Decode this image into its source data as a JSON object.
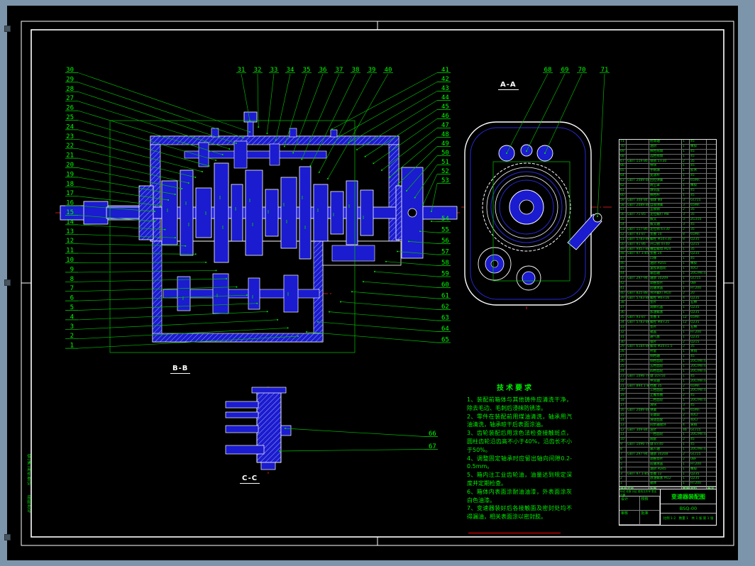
{
  "colors": {
    "desktop": "#7d95aa",
    "sheet": "#000000",
    "frame_white": "#ffffff",
    "part_blue": "#1b1bcf",
    "leader_green": "#00e000",
    "centerline_red": "#ff0000"
  },
  "drawing": {
    "view_labels": {
      "aa": "A-A",
      "bb": "B-B",
      "cc": "C-C"
    },
    "margin_labels": [
      "借(通)用件登记",
      "底图总号"
    ],
    "callouts": {
      "left": [
        "30",
        "29",
        "28",
        "27",
        "26",
        "25",
        "24",
        "23",
        "22",
        "21",
        "20",
        "19",
        "18",
        "17",
        "16",
        "15",
        "14",
        "13",
        "12",
        "11",
        "10",
        "9",
        "8",
        "7",
        "6",
        "5",
        "4",
        "3",
        "2",
        "1"
      ],
      "top": [
        "31",
        "32",
        "33",
        "34",
        "35",
        "36",
        "37",
        "38",
        "39",
        "40"
      ],
      "right_upper": [
        "41",
        "42",
        "43",
        "44",
        "45",
        "46",
        "47",
        "48",
        "49",
        "50",
        "51",
        "52",
        "53"
      ],
      "right_lower": [
        "54",
        "55",
        "56",
        "57",
        "58",
        "59",
        "60",
        "61",
        "62",
        "63",
        "64",
        "65"
      ],
      "cc_view": [
        "66",
        "67"
      ],
      "aa_top": [
        "68",
        "69",
        "70",
        "71"
      ]
    },
    "tech": {
      "title": "技术要求",
      "lines": [
        "1、装配前箱体与其他铸件应清洗干净，除去毛边、毛刺后浸抹防锈漆。",
        "2、零件在装配前用煤油清洗，轴承用汽油清洗，轴承晾干后表面涂油。",
        "3、齿轮装配后用涂色法检查接触斑点，圆柱齿轮沿齿高不小于40%，沿齿长不小于50%。",
        "4、调整固定轴承时应留出轴向间隙0.2-0.5mm。",
        "5、箱内注工业齿轮油，油量达到规定深度并定期检查。",
        "6、箱体内表面涂耐油油漆，外表面涂灰白色油漆。",
        "7、变速器装好后各接触面及密封处均不得漏油，相关表面涂以密封胶。"
      ]
    },
    "bom": {
      "headers": [
        "序号",
        "代号",
        "名称",
        "数量",
        "材料",
        "备注"
      ],
      "rows": [
        [
          "71",
          "",
          "摇臂轴",
          "1",
          "45",
          ""
        ],
        [
          "70",
          "",
          "油封",
          "1",
          "橡胶",
          ""
        ],
        [
          "69",
          "",
          "换档摇臂",
          "1",
          "45",
          ""
        ],
        [
          "68",
          "",
          "选档摇臂",
          "1",
          "45",
          ""
        ],
        [
          "67",
          "GB/T 119-86",
          "锁销 5×30",
          "2",
          "35",
          ""
        ],
        [
          "66",
          "",
          "导块",
          "1",
          "45",
          ""
        ],
        [
          "65",
          "",
          "手柄球",
          "1",
          "胶木",
          ""
        ],
        [
          "64",
          "",
          "变速杆",
          "1",
          "45",
          ""
        ],
        [
          "63",
          "GB/T 2089-80",
          "回位弹簧",
          "2",
          "65Mn",
          ""
        ],
        [
          "62",
          "",
          "防尘罩",
          "1",
          "橡胶",
          ""
        ],
        [
          "61",
          "",
          "球头座",
          "1",
          "45",
          ""
        ],
        [
          "60",
          "",
          "换档杆",
          "1",
          "45",
          ""
        ],
        [
          "59",
          "GB/T 308-84",
          "钢球 Φ8",
          "3",
          "GCr15",
          ""
        ],
        [
          "58",
          "GB/T 2089-80",
          "自锁弹簧",
          "3",
          "65Mn",
          ""
        ],
        [
          "57",
          "",
          "互锁销",
          "2",
          "35",
          ""
        ],
        [
          "56",
          "GB/T 71-85",
          "定位螺钉 M8",
          "3",
          "35",
          ""
        ],
        [
          "55",
          "",
          "拨叉",
          "3",
          "ZG310",
          ""
        ],
        [
          "54",
          "",
          "拨叉轴",
          "3",
          "45",
          ""
        ],
        [
          "53",
          "GB/T 117-86",
          "定位销 6×30",
          "2",
          "35",
          ""
        ],
        [
          "52",
          "GB/T 93-87",
          "垫圈 10",
          "8",
          "65Mn",
          ""
        ],
        [
          "51",
          "GB/T 5783-86",
          "螺栓 M10×30",
          "8",
          "Q235",
          ""
        ],
        [
          "50",
          "GB/T 91-86",
          "开口销 4×40",
          "1",
          "Q215",
          ""
        ],
        [
          "49",
          "GB/T 9457-88",
          "槽型螺母 M24",
          "1",
          "35",
          ""
        ],
        [
          "48",
          "GB/T 97.1-85",
          "垫圈 24",
          "1",
          "Q235",
          ""
        ],
        [
          "47",
          "",
          "凸缘",
          "1",
          "45",
          ""
        ],
        [
          "46",
          "",
          "油封 PD55",
          "1",
          "橡胶",
          ""
        ],
        [
          "45",
          "",
          "里程表齿轮",
          "1",
          "40Cr",
          ""
        ],
        [
          "44",
          "",
          "输出轴",
          "1",
          "20CrMnTi",
          ""
        ],
        [
          "43",
          "GB/T 297-94",
          "轴承 30209",
          "1",
          "GCr15",
          ""
        ],
        [
          "42",
          "",
          "调整垫片",
          "1",
          "08F",
          ""
        ],
        [
          "41",
          "",
          "后轴承盖",
          "1",
          "HT200",
          ""
        ],
        [
          "40",
          "GB/T 825-88",
          "吊环螺钉 M10",
          "2",
          "20",
          ""
        ],
        [
          "39",
          "GB/T 5783-86",
          "螺栓 M6×16",
          "4",
          "Q235",
          ""
        ],
        [
          "38",
          "",
          "垫片",
          "1",
          "石棉",
          ""
        ],
        [
          "37",
          "",
          "观察孔盖",
          "1",
          "Q235",
          ""
        ],
        [
          "36",
          "",
          "加油螺塞",
          "1",
          "Q235",
          ""
        ],
        [
          "35",
          "GB/T 93-87",
          "垫圈 8",
          "12",
          "65Mn",
          ""
        ],
        [
          "34",
          "GB/T 5783-86",
          "螺栓 M8×25",
          "12",
          "Q235",
          ""
        ],
        [
          "33",
          "",
          "垫片",
          "1",
          "石棉",
          ""
        ],
        [
          "32",
          "",
          "箱盖",
          "1",
          "HT200",
          ""
        ],
        [
          "31",
          "",
          "通气塞",
          "1",
          "Q235",
          ""
        ],
        [
          "30",
          "",
          "锁片",
          "2",
          "Q215",
          ""
        ],
        [
          "29",
          "GB/T 6184-86",
          "螺母 M20×1.5",
          "2",
          "35",
          ""
        ],
        [
          "28",
          "",
          "衬套",
          "1",
          "青铜",
          ""
        ],
        [
          "27",
          "",
          "倒档轴",
          "1",
          "45",
          ""
        ],
        [
          "26",
          "",
          "倒档齿轮",
          "1",
          "20CrMnTi",
          ""
        ],
        [
          "25",
          "",
          "五档齿轮",
          "1",
          "20CrMnTi",
          ""
        ],
        [
          "24",
          "",
          "四档齿轮",
          "1",
          "20CrMnTi",
          ""
        ],
        [
          "23",
          "GB/T 1096-79",
          "键 10×50",
          "1",
          "45",
          ""
        ],
        [
          "22",
          "",
          "中间轴",
          "1",
          "20CrMnTi",
          ""
        ],
        [
          "21",
          "GB/T 894.1-86",
          "挡圈 35",
          "2",
          "65Mn",
          ""
        ],
        [
          "20",
          "",
          "三档齿轮",
          "1",
          "20CrMnTi",
          ""
        ],
        [
          "19",
          "",
          "止推垫圈",
          "2",
          "45",
          ""
        ],
        [
          "18",
          "",
          "二档齿轮",
          "1",
          "20CrMnTi",
          ""
        ],
        [
          "17",
          "",
          "滑块",
          "3",
          "45",
          ""
        ],
        [
          "16",
          "GB/T 2089-80",
          "弹簧",
          "6",
          "65Mn",
          ""
        ],
        [
          "15",
          "",
          "花键毂",
          "2",
          "40Cr",
          ""
        ],
        [
          "14",
          "",
          "滑动齿套",
          "2",
          "40Cr",
          ""
        ],
        [
          "13",
          "",
          "同步器锁环",
          "4",
          "黄铜",
          ""
        ],
        [
          "12",
          "GB/T 309-84",
          "滚针",
          "46",
          "GCr15",
          ""
        ],
        [
          "11",
          "",
          "一档齿轮",
          "1",
          "20CrMnTi",
          ""
        ],
        [
          "10",
          "",
          "隔套",
          "2",
          "45",
          ""
        ],
        [
          "9",
          "GB/T 1096-79",
          "键 8×40",
          "1",
          "45",
          ""
        ],
        [
          "8",
          "",
          "输入轴",
          "1",
          "20CrMnTi",
          ""
        ],
        [
          "7",
          "GB/T 297-94",
          "轴承 30208",
          "2",
          "GCr15",
          ""
        ],
        [
          "6",
          "",
          "调整垫片",
          "2",
          "08F",
          ""
        ],
        [
          "5",
          "",
          "前轴承盖",
          "1",
          "HT200",
          ""
        ],
        [
          "4",
          "",
          "油封 PD45",
          "1",
          "橡胶",
          ""
        ],
        [
          "3",
          "GB/T 97.1-85",
          "垫圈 12",
          "1",
          "Q235",
          ""
        ],
        [
          "2",
          "",
          "放油螺塞 M12",
          "1",
          "Q235",
          ""
        ],
        [
          "1",
          "",
          "箱体",
          "1",
          "HT200",
          ""
        ]
      ]
    },
    "title_block": {
      "rev_header": "标记 处数 分区 更改文件号 签名 日期",
      "roles": [
        "设计",
        "校核",
        "审核",
        "批准"
      ],
      "title": "变速器装配图",
      "code": "BSQ-00",
      "meta": "比例 1:2　数量 1　共 1 张 第 1 张"
    }
  }
}
